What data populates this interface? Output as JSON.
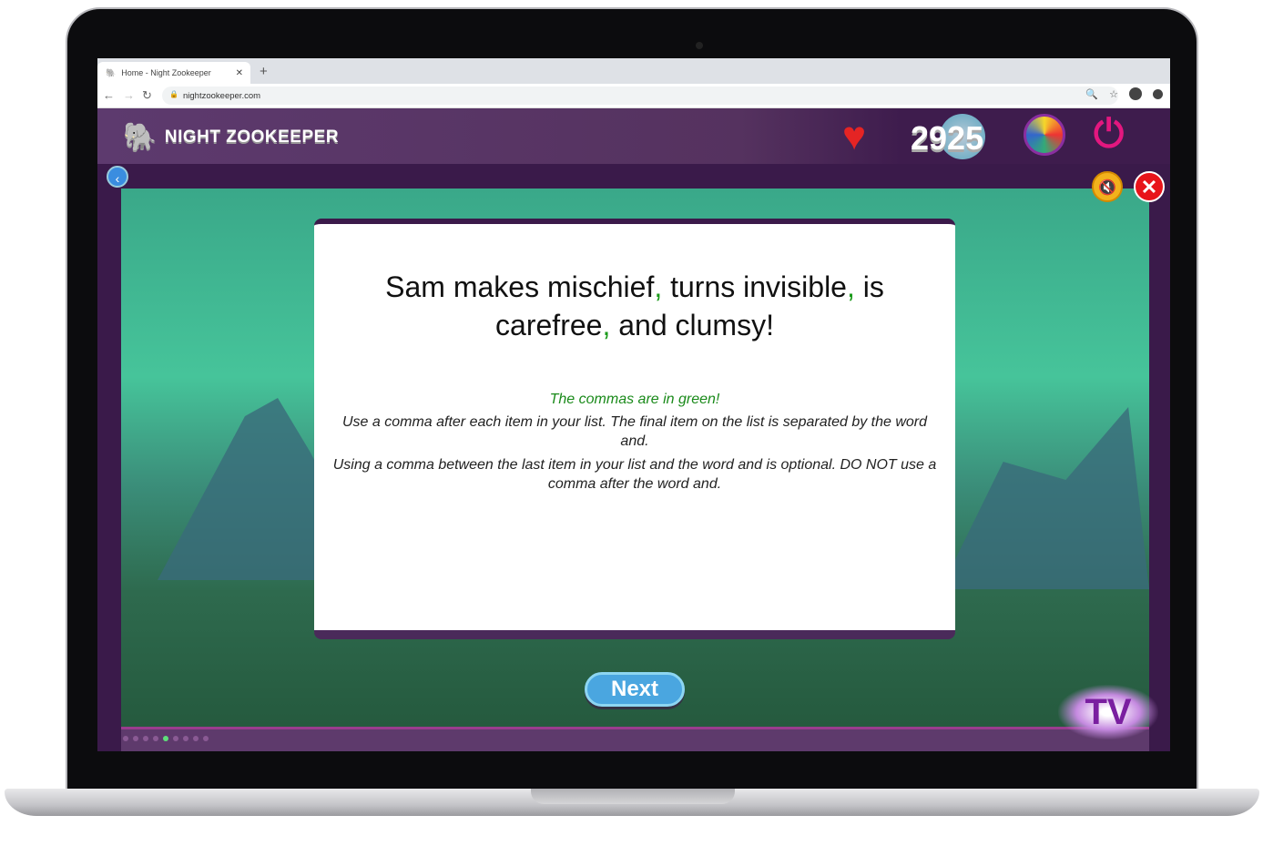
{
  "browser": {
    "tab_title": "Home - Night Zookeeper",
    "url": "nightzookeeper.com"
  },
  "header": {
    "logo_text": "NIGHT ZOOKEEPER",
    "score": "2925"
  },
  "card": {
    "sentence_parts": [
      "Sam makes mischief",
      ",",
      " turns invisible",
      ",",
      " is carefree",
      ",",
      " and clumsy!"
    ],
    "hint": "The commas are in green!",
    "rule1": "Use a comma after each item in your list. The final item on the list is separated by the word and.",
    "rule2": "Using a comma between the last item in your list and the word and is optional. DO NOT use a comma after the word and."
  },
  "next_label": "Next",
  "progress": {
    "total": 9,
    "current": 5
  },
  "tv_logo": "TV",
  "colors": {
    "comma": "#1a9a1a",
    "accent": "#4aa6e0",
    "header": "#55325f"
  }
}
